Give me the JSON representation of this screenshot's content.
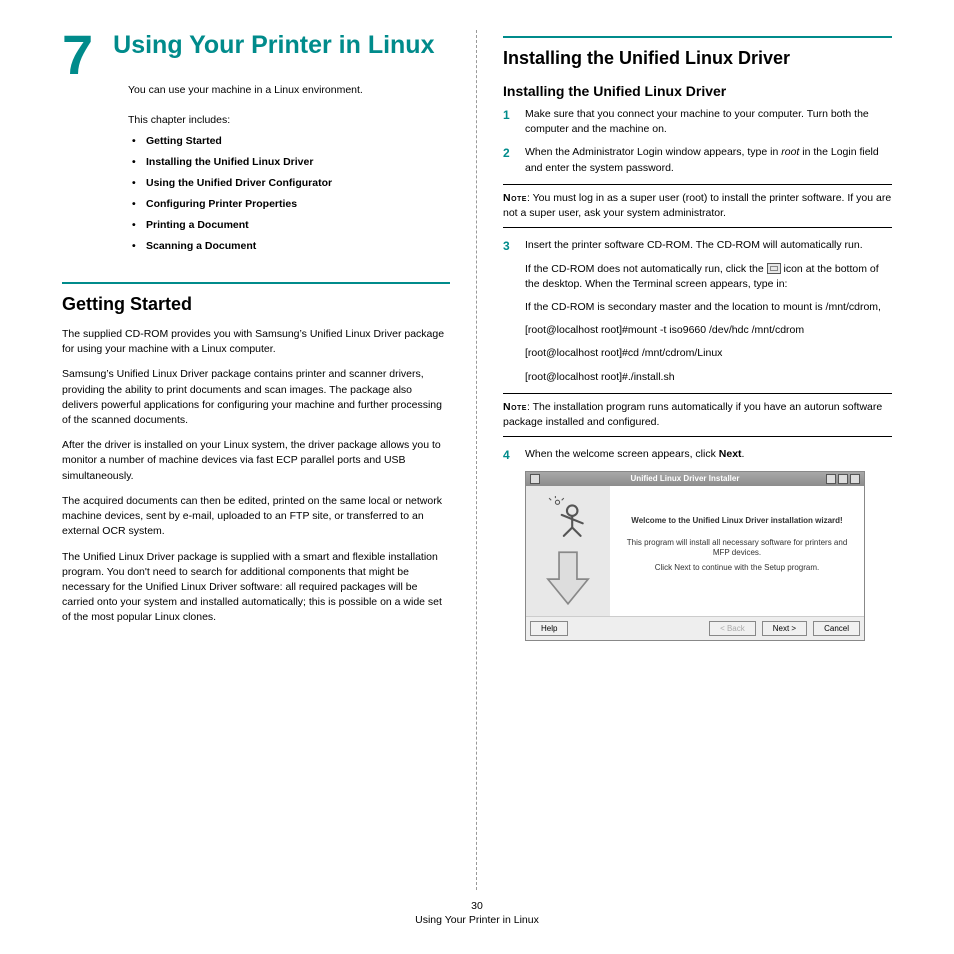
{
  "chapter": {
    "number": "7",
    "title": "Using Your Printer in Linux"
  },
  "intro1": "You can use your machine in a Linux environment.",
  "intro2": "This chapter includes:",
  "toc": [
    "Getting Started",
    "Installing the Unified Linux Driver",
    "Using the Unified Driver Configurator",
    "Configuring Printer Properties",
    "Printing a Document",
    "Scanning a Document"
  ],
  "left": {
    "h2": "Getting Started",
    "paras": [
      "The supplied CD-ROM provides you with Samsung’s Unified Linux Driver package for using your machine with a Linux computer.",
      "Samsung’s Unified Linux Driver package contains printer and scanner drivers, providing the ability to print documents and scan images. The package also delivers powerful applications for configuring your machine and further processing of the scanned documents.",
      "After the driver is installed on your Linux system, the driver package allows you to monitor a number of machine devices via fast ECP parallel ports and USB simultaneously.",
      "The acquired documents can then be edited, printed on the same local or network machine devices, sent by e-mail, uploaded to an FTP site, or transferred to an external OCR system.",
      "The Unified Linux Driver package is supplied with a smart and flexible installation program. You don't need to search for additional components that might be necessary for the Unified Linux Driver software: all required packages will be carried onto your system and installed automatically; this is possible on a wide set of the most popular Linux clones."
    ]
  },
  "right": {
    "h2": "Installing the Unified Linux Driver",
    "h3": "Installing the Unified Linux Driver",
    "step1": "Make sure that you connect your machine to your computer. Turn both the computer and the machine on.",
    "step2_a": "When the Administrator Login window appears, type in ",
    "step2_root": "root",
    "step2_b": " in the Login field and enter the system password.",
    "note1_label": "Note",
    "note1": ": You must log in as a super user (root) to install the printer software. If you are not a super user, ask your system administrator.",
    "step3": "Insert the printer software CD-ROM. The CD-ROM will automatically run.",
    "inset1_a": "If the CD-ROM does not automatically run, click the ",
    "inset1_b": " icon at the bottom of the desktop. When the Terminal screen appears, type in:",
    "inset2": "If the CD-ROM is secondary master and the location to mount is /mnt/cdrom,",
    "cmd1": "[root@localhost root]#mount -t iso9660 /dev/hdc /mnt/cdrom",
    "cmd2": "[root@localhost root]#cd /mnt/cdrom/Linux",
    "cmd3": "[root@localhost root]#./install.sh",
    "note2_label": "Note",
    "note2": ": The installation program runs automatically if you have an autorun software package installed and configured.",
    "step4_a": "When the welcome screen appears, click ",
    "step4_b": "Next",
    "step4_c": "."
  },
  "installer": {
    "title": "Unified Linux Driver Installer",
    "welcome": "Welcome to the Unified Linux Driver installation wizard!",
    "line1": "This program will install all necessary software for printers and MFP devices.",
    "line2": "Click Next to continue with the Setup program.",
    "help": "Help",
    "back": "< Back",
    "next": "Next >",
    "cancel": "Cancel"
  },
  "footer": {
    "page": "30",
    "title": "Using Your Printer in Linux"
  }
}
